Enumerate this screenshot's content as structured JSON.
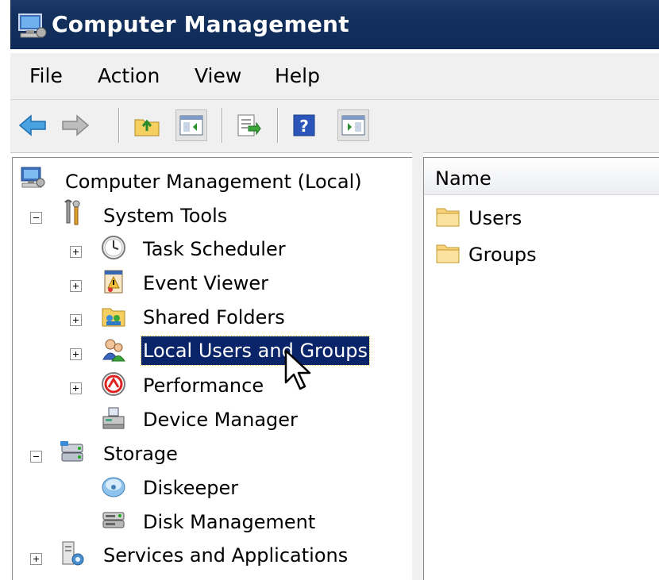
{
  "window": {
    "title": "Computer Management",
    "title_icon": "computer-management-icon"
  },
  "menu": {
    "items": [
      "File",
      "Action",
      "View",
      "Help"
    ]
  },
  "toolbar": {
    "buttons": [
      "back-arrow-icon",
      "forward-arrow-icon",
      "up-folder-icon",
      "show-hide-console-tree-icon",
      "export-list-icon",
      "help-icon",
      "show-hide-action-pane-icon"
    ]
  },
  "tree": {
    "root": "Computer Management (Local)",
    "system_tools": "System Tools",
    "task_scheduler": "Task Scheduler",
    "event_viewer": "Event Viewer",
    "shared_folders": "Shared Folders",
    "local_users_groups": "Local Users and Groups",
    "performance": "Performance",
    "device_manager": "Device Manager",
    "storage": "Storage",
    "diskeeper": "Diskeeper",
    "disk_management": "Disk Management",
    "services_apps": "Services and Applications",
    "selected": "Local Users and Groups"
  },
  "list": {
    "column": "Name",
    "items": [
      "Users",
      "Groups"
    ]
  },
  "colors": {
    "title_bar": "#14315e",
    "selection": "#0a246a"
  }
}
